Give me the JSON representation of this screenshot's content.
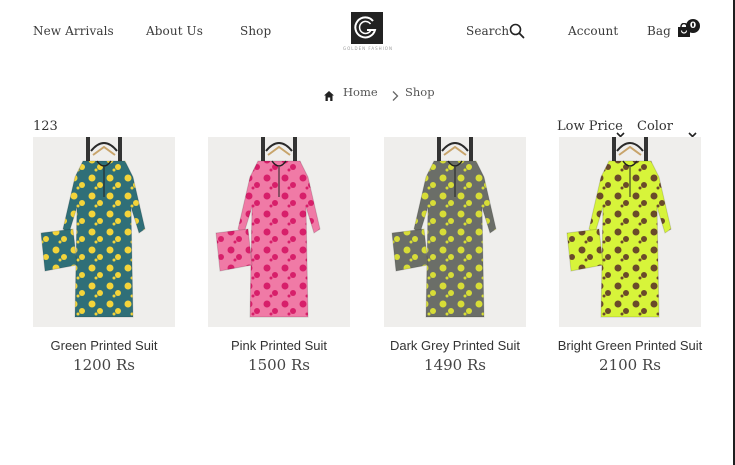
{
  "nav": {
    "new_arrivals": "New Arrivals",
    "about_us": "About Us",
    "shop": "Shop",
    "search": "Search",
    "account": "Account",
    "bag": "Bag",
    "bag_count": "0"
  },
  "brand": {
    "logo_mark": "G",
    "logo_text": "GOLDEN FASHION"
  },
  "breadcrumb": {
    "home": "Home",
    "current": "Shop"
  },
  "listing": {
    "count": "123",
    "sort_label": "Low Price",
    "filter_label": "Color"
  },
  "products": [
    {
      "name": "Green Printed Suit",
      "price": "1200 Rs",
      "body_color": "#2f6f78",
      "print_color": "#f3d43a"
    },
    {
      "name": "Pink Printed Suit",
      "price": "1500 Rs",
      "body_color": "#f07aa6",
      "print_color": "#d71f6a"
    },
    {
      "name": "Dark Grey Printed Suit",
      "price": "1490 Rs",
      "body_color": "#6b6e68",
      "print_color": "#d7dd37"
    },
    {
      "name": "Bright Green Printed Suit",
      "price": "2100 Rs",
      "body_color": "#d7f43a",
      "print_color": "#6a4a2a"
    }
  ],
  "icons": [
    "home-icon",
    "chevron-right-icon",
    "search-icon",
    "shopping-bag-icon",
    "chevron-down-icon"
  ]
}
